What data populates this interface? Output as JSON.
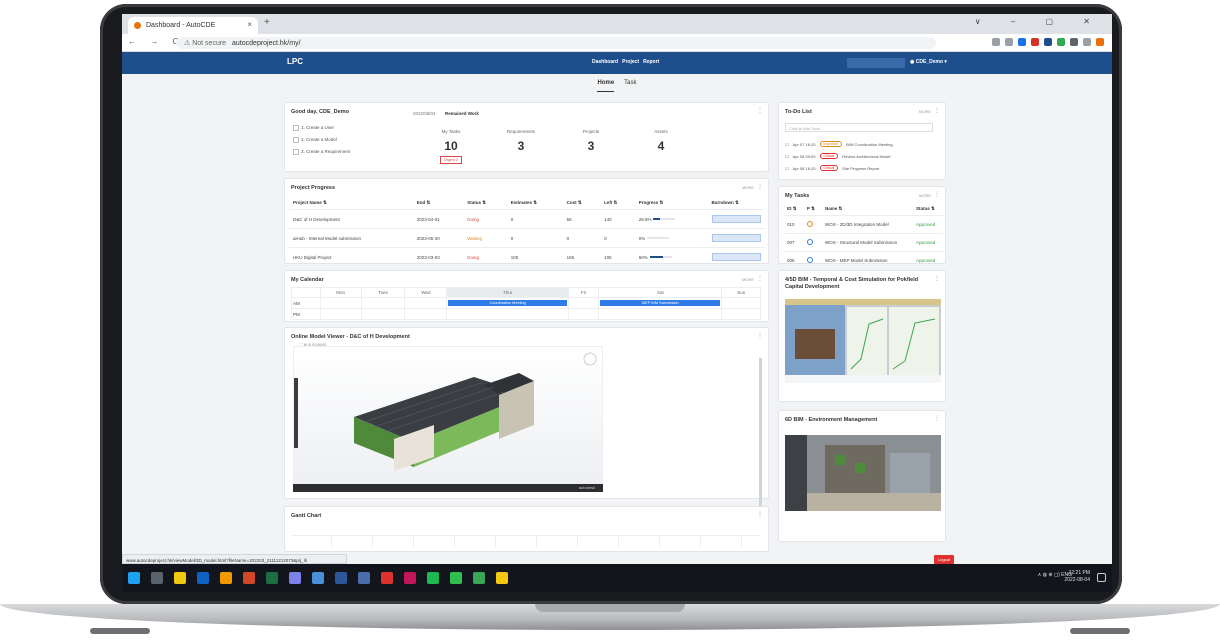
{
  "browser": {
    "tab_title": "Dashboard - AutoCDE",
    "tab_close": "×",
    "new_tab": "+",
    "window_controls": "∨ – ▢ ✕",
    "nav_controls": "← → C",
    "not_secure": "⚠ Not secure",
    "url": "autocdeproject.hk/my/",
    "status_url": "www.autocdeproject.hk/viewModel/3D_model.html?fileName=202203_21111212073&prj_ih"
  },
  "app": {
    "logo": "LPC",
    "nav": [
      "Dashboard",
      "Project",
      "Report"
    ],
    "user": "CDE_Demo",
    "subnav": [
      "Home",
      "Task"
    ],
    "logout": "Logout"
  },
  "welcome": {
    "greeting": "Good day, CDE_Demo",
    "date_label": "2022/08/04",
    "date_sub": "Remained Work",
    "steps": [
      "1. Create a User",
      "2. Create a Model",
      "3. Create a Requirement"
    ],
    "stats": [
      {
        "label": "My Tasks",
        "value": "10",
        "badge": "Urgent 2"
      },
      {
        "label": "Requirements",
        "value": "3"
      },
      {
        "label": "Projects",
        "value": "3"
      },
      {
        "label": "Assets",
        "value": "4"
      }
    ]
  },
  "progress": {
    "title": "Project Progress",
    "more": "MORE",
    "columns": [
      "Project Name ⇅",
      "End ⇅",
      "Status ⇅",
      "Estimates ⇅",
      "Cost ⇅",
      "Left ⇅",
      "Progress ⇅",
      "Burndown ⇅"
    ],
    "rows": [
      {
        "name": "D&C of H Development",
        "end": "2023-04-01",
        "status": "Doing",
        "estimates": "0",
        "cost": "56",
        "left": "140",
        "progress": "28.6%"
      },
      {
        "name": "aiHub - Internal Model submission",
        "end": "2023-05-20",
        "status": "Waiting",
        "estimates": "0",
        "cost": "0",
        "left": "0",
        "progress": "0%"
      },
      {
        "name": "HKU Digital Project",
        "end": "2023-03-03",
        "status": "Doing",
        "estimates": "100",
        "cost": "165",
        "left": "105",
        "progress": "60%"
      }
    ]
  },
  "todo": {
    "title": "To-Do List",
    "more": "MORE",
    "placeholder": "Click to Add Todo",
    "items": [
      {
        "date": "Apr 07 16:20",
        "tag": "Important",
        "text": "BIM Coordination Meeting",
        "color": "#e08b24"
      },
      {
        "date": "Apr 08 09:00",
        "tag": "Critical",
        "text": "Review Architectural Model",
        "color": "#e03131"
      },
      {
        "date": "Apr 08 16:20",
        "tag": "Critical",
        "text": "Site Progress Report",
        "color": "#e03131"
      }
    ]
  },
  "tasks": {
    "title": "My Tasks",
    "more": "MORE",
    "columns": [
      "ID ⇅",
      "P ⇅",
      "Name ⇅",
      "Status ⇅"
    ],
    "rows": [
      {
        "id": "010",
        "p": "3",
        "name": "WOS - 2D/3D Integration Model",
        "status": "Approved",
        "pcolor": "#e08b24"
      },
      {
        "id": "007",
        "p": "2",
        "name": "WOS - Structural Model Submission",
        "status": "Approved",
        "pcolor": "#2f7be8"
      },
      {
        "id": "006",
        "p": "2",
        "name": "WOS - MEP Model Submission",
        "status": "Approved",
        "pcolor": "#2f7be8"
      }
    ]
  },
  "calendar": {
    "title": "My Calendar",
    "more": "MORE",
    "days": [
      "",
      "Mon",
      "Tues",
      "Wed",
      "Thur",
      "Fri",
      "Sat",
      "Sun"
    ],
    "rows": [
      "AM",
      "PM"
    ],
    "events": {
      "thur_am": "Coordination Meeting",
      "sat_am": "MEP BIM Submission"
    }
  },
  "viewer": {
    "title": "Online Model Viewer - D&C of H Development",
    "toolbar": "⬚ ⊕  ⊘   ROAMS",
    "footer": "autodesk"
  },
  "bim4d": {
    "title": "4/5D BIM - Temporal & Cost Simulation for Pokfield Capital Development"
  },
  "bim6d": {
    "title": "6D BIM - Environment Management"
  },
  "gantt": {
    "title": "Gantt Chart"
  },
  "taskbar": {
    "tray": "∧ ◍ ⊕ ◻) ENG",
    "time": "12:21 PM",
    "date": "2022-08-04"
  }
}
